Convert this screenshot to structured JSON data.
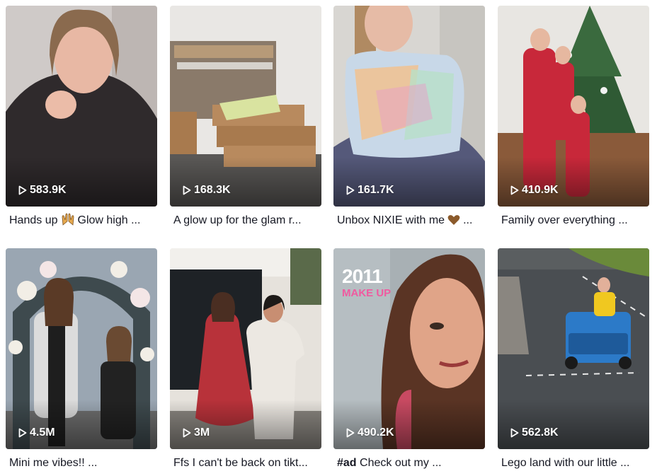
{
  "colors": {
    "caption_text": "#161823",
    "overlay_pink": "#f05aa0",
    "view_text": "#ffffff"
  },
  "videos": [
    {
      "views": "583.9K",
      "caption": "Hands up",
      "emoji": "raising-hands-icon",
      "caption_after": "Glow high ..."
    },
    {
      "views": "168.3K",
      "caption": "A glow up for the glam r..."
    },
    {
      "views": "161.7K",
      "caption": "Unbox NIXIE with me",
      "emoji": "brown-heart-icon",
      "caption_after": "..."
    },
    {
      "views": "410.9K",
      "caption": "Family over everything ..."
    },
    {
      "views": "4.5M",
      "caption": "Mini me vibes!! ..."
    },
    {
      "views": "3M",
      "caption": "Ffs I can't be back on tikt..."
    },
    {
      "views": "490.2K",
      "hashtag": "#ad",
      "caption": "Check out my ...",
      "overlay_year": "2011",
      "overlay_sub": "MAKE UP"
    },
    {
      "views": "562.8K",
      "caption": "Lego land with our little ..."
    }
  ]
}
